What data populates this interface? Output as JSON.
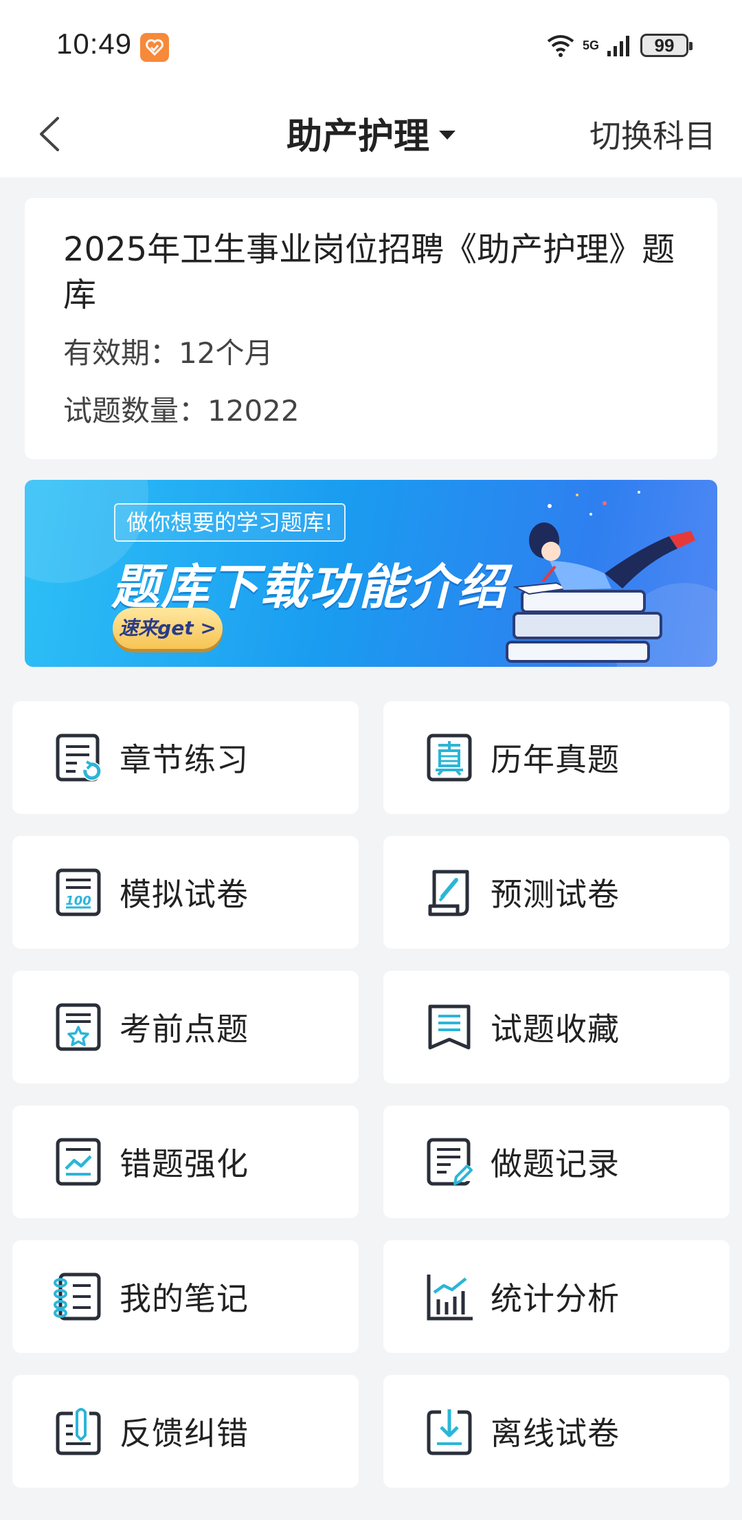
{
  "status_bar": {
    "time": "10:49",
    "network": "5G",
    "battery": "99"
  },
  "header": {
    "title": "助产护理",
    "switch_label": "切换科目"
  },
  "info_card": {
    "title": "2025年卫生事业岗位招聘《助产护理》题库",
    "validity": "有效期：12个月",
    "question_count": "试题数量：12022"
  },
  "banner": {
    "tagline": "做你想要的学习题库!",
    "headline": "题库下载功能介绍",
    "cta": "速来get >"
  },
  "menu": [
    {
      "label": "章节练习",
      "icon": "chapter-practice-icon"
    },
    {
      "label": "历年真题",
      "icon": "past-exams-icon"
    },
    {
      "label": "模拟试卷",
      "icon": "mock-exam-icon"
    },
    {
      "label": "预测试卷",
      "icon": "prediction-exam-icon"
    },
    {
      "label": "考前点题",
      "icon": "pre-exam-tips-icon"
    },
    {
      "label": "试题收藏",
      "icon": "favorites-icon"
    },
    {
      "label": "错题强化",
      "icon": "wrong-questions-icon"
    },
    {
      "label": "做题记录",
      "icon": "practice-record-icon"
    },
    {
      "label": "我的笔记",
      "icon": "notes-icon"
    },
    {
      "label": "统计分析",
      "icon": "statistics-icon"
    },
    {
      "label": "反馈纠错",
      "icon": "feedback-icon"
    },
    {
      "label": "离线试卷",
      "icon": "offline-download-icon"
    }
  ],
  "colors": {
    "accent": "#2bb5d8",
    "icon_stroke": "#2a2f3a",
    "background": "#f3f4f6"
  }
}
